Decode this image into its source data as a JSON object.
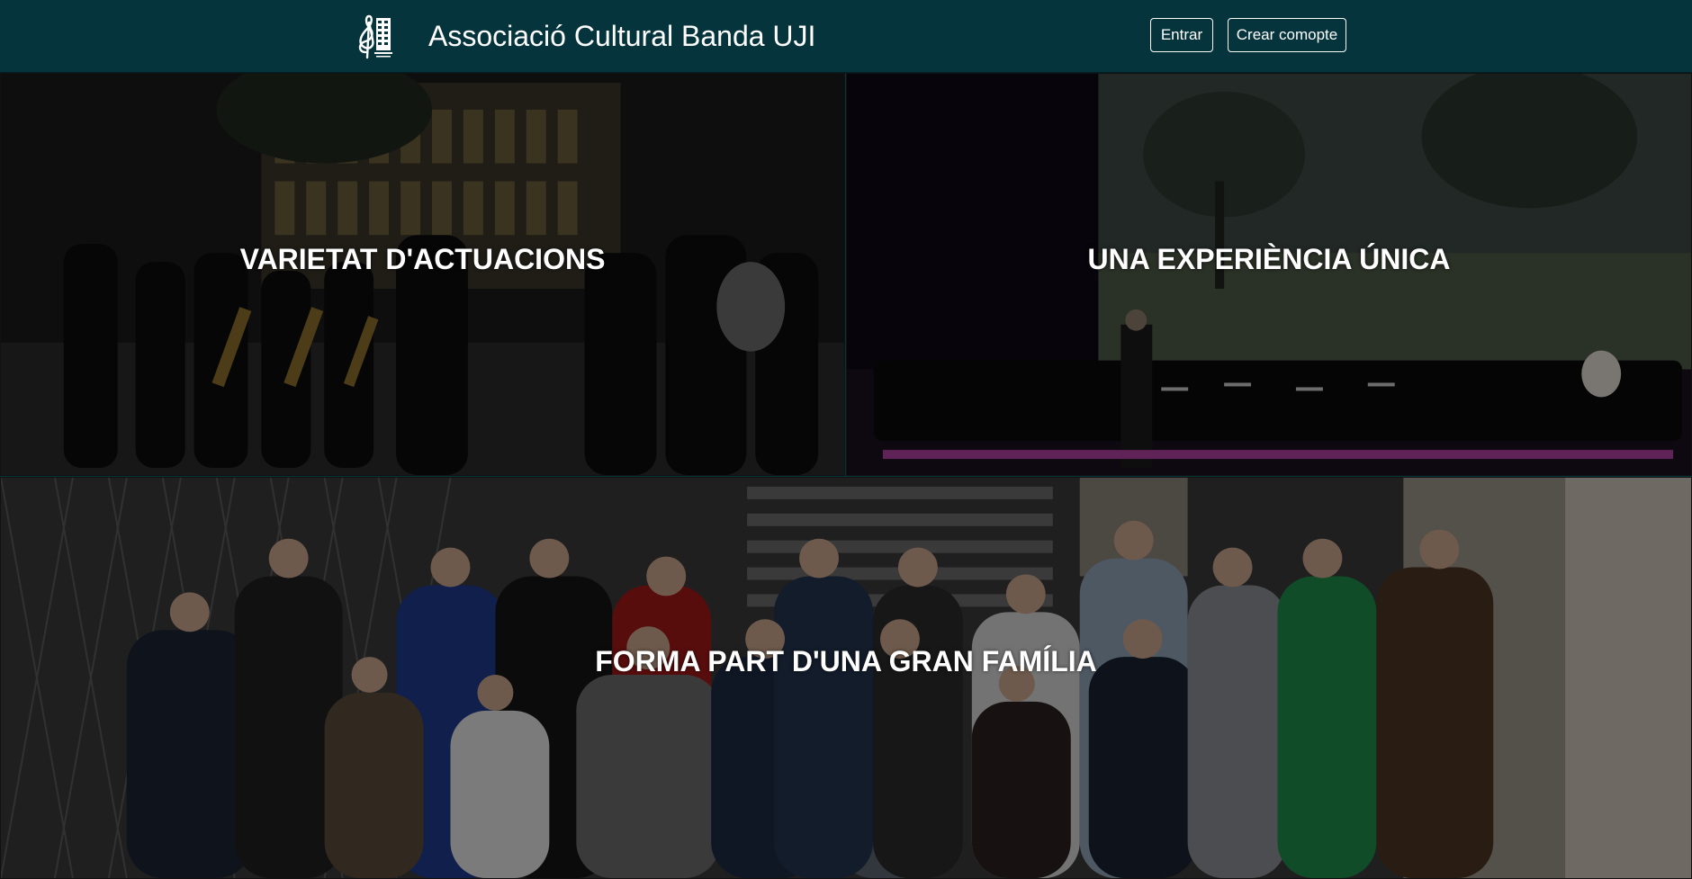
{
  "header": {
    "logo_icon": "treble-clef-building-logo",
    "title": "Associació Cultural Banda UJI",
    "login_label": "Entrar",
    "signup_label": "Crear comopte"
  },
  "panels": [
    {
      "caption": "VARIETAT D'ACTUACIONS",
      "image": "night street parade of marching band with saxophones and tuba"
    },
    {
      "caption": "UNA EXPERIÈNCIA ÚNICA",
      "image": "concert band performing on stage with conductor and projected forest backdrop"
    },
    {
      "caption": "FORMA PART D'UNA GRAN FAMÍLIA",
      "image": "large group photo of band members on a city street"
    }
  ],
  "colors": {
    "navbar_bg": "#05343d",
    "text": "#ffffff"
  }
}
